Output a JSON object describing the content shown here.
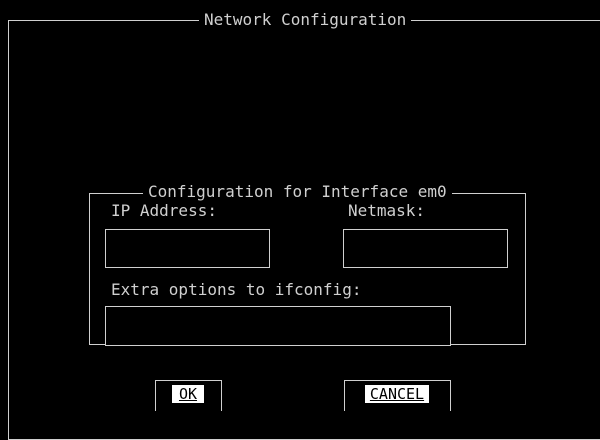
{
  "dialog": {
    "title": "Network Configuration"
  },
  "interface_group": {
    "title": "Configuration for Interface em0",
    "ip_address": {
      "label": "IP Address:",
      "value": "",
      "placeholder": ""
    },
    "netmask": {
      "label": "Netmask:",
      "value": "",
      "placeholder": ""
    },
    "extra_options": {
      "label": "Extra options to ifconfig:",
      "value": "",
      "placeholder": ""
    }
  },
  "buttons": {
    "ok_label": "OK",
    "cancel_label": "CANCEL"
  },
  "colors": {
    "background": "#000000",
    "foreground": "#d0d0d0",
    "button_highlight": "#ffffff"
  }
}
